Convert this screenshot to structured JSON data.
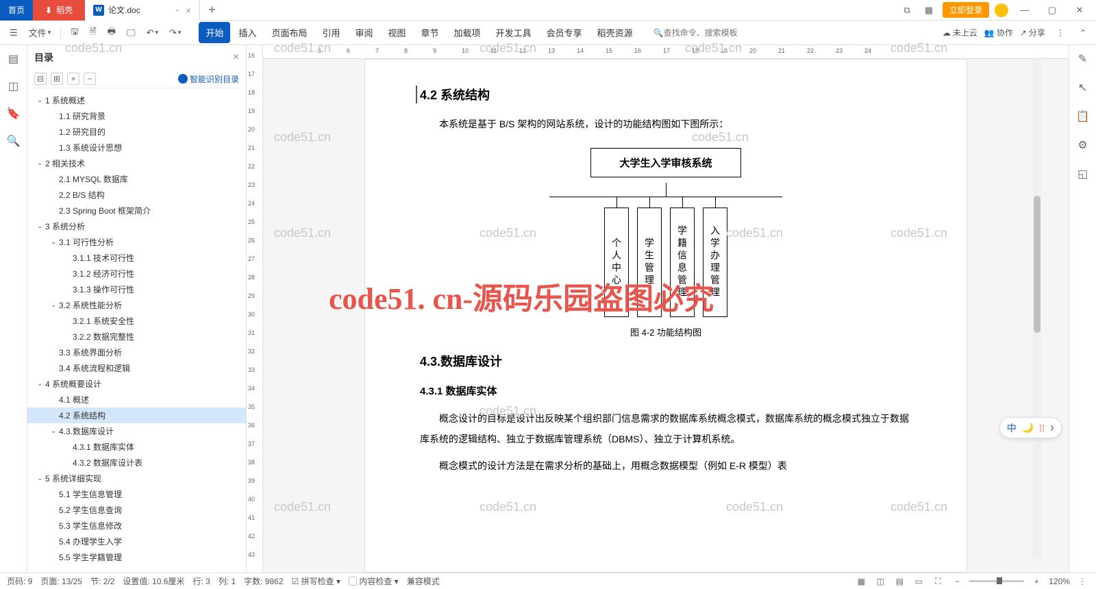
{
  "titlebar": {
    "home": "首页",
    "shell": "稻壳",
    "doc_name": "论文.doc",
    "login": "立即登录"
  },
  "toolbar": {
    "file": "文件",
    "tabs": [
      "开始",
      "插入",
      "页面布局",
      "引用",
      "审阅",
      "视图",
      "章节",
      "加载项",
      "开发工具",
      "会员专享",
      "稻壳资源"
    ],
    "search_ph": "查找命令、搜索模板",
    "cloud": "未上云",
    "collab": "协作",
    "share": "分享"
  },
  "outline": {
    "title": "目录",
    "smart": "智能识别目录",
    "items": [
      {
        "t": "1 系统概述",
        "l": 0,
        "c": true
      },
      {
        "t": "1.1 研究背景",
        "l": 1
      },
      {
        "t": "1.2 研究目的",
        "l": 1
      },
      {
        "t": "1.3 系统设计思想",
        "l": 1
      },
      {
        "t": "2 相关技术",
        "l": 0,
        "c": true
      },
      {
        "t": "2.1 MYSQL 数据库",
        "l": 1
      },
      {
        "t": "2.2 B/S 结构",
        "l": 1
      },
      {
        "t": "2.3 Spring Boot 框架简介",
        "l": 1
      },
      {
        "t": "3 系统分析",
        "l": 0,
        "c": true
      },
      {
        "t": "3.1 可行性分析",
        "l": 1,
        "c": true
      },
      {
        "t": "3.1.1 技术可行性",
        "l": 2
      },
      {
        "t": "3.1.2 经济可行性",
        "l": 2
      },
      {
        "t": "3.1.3 操作可行性",
        "l": 2
      },
      {
        "t": "3.2 系统性能分析",
        "l": 1,
        "c": true
      },
      {
        "t": "3.2.1 系统安全性",
        "l": 2
      },
      {
        "t": "3.2.2 数据完整性",
        "l": 2
      },
      {
        "t": "3.3 系统界面分析",
        "l": 1
      },
      {
        "t": "3.4 系统流程和逻辑",
        "l": 1
      },
      {
        "t": "4 系统概要设计",
        "l": 0,
        "c": true
      },
      {
        "t": "4.1 概述",
        "l": 1
      },
      {
        "t": "4.2 系统结构",
        "l": 1,
        "sel": true
      },
      {
        "t": "4.3.数据库设计",
        "l": 1,
        "c": true
      },
      {
        "t": "4.3.1 数据库实体",
        "l": 2
      },
      {
        "t": "4.3.2 数据库设计表",
        "l": 2
      },
      {
        "t": "5 系统详细实现",
        "l": 0,
        "c": true
      },
      {
        "t": "5.1 学生信息管理",
        "l": 1
      },
      {
        "t": "5.2 学生信息查询",
        "l": 1
      },
      {
        "t": "5.3 学生信息修改",
        "l": 1
      },
      {
        "t": "5.4 办理学生入学",
        "l": 1
      },
      {
        "t": "5.5 学生学籍管理",
        "l": 1
      }
    ]
  },
  "doc": {
    "h42": "4.2 系统结构",
    "p1": "本系统是基于 B/S 架构的网站系统，设计的功能结构图如下图所示：",
    "diag_root": "大学生入学审核系统",
    "diag_boxes": [
      "个人中心",
      "学生管理",
      "学籍信息管理",
      "入学办理管理"
    ],
    "diag_caption": "图 4-2 功能结构图",
    "h43": "4.3.数据库设计",
    "h431": "4.3.1 数据库实体",
    "p2": "概念设计的目标是设计出反映某个组织部门信息需求的数据库系统概念模式，数据库系统的概念模式独立于数据库系统的逻辑结构、独立于数据库管理系统（DBMS）、独立于计算机系统。",
    "p3": "概念模式的设计方法是在需求分析的基础上，用概念数据模型（例如 E-R 模型）表"
  },
  "statusbar": {
    "page_no": "页码: 9",
    "page": "页面: 13/25",
    "sec": "节: 2/2",
    "setval": "设置值: 10.6厘米",
    "line": "行: 3",
    "col": "列: 1",
    "words": "字数: 9862",
    "spell": "拼写检查",
    "content": "内容检查",
    "compat": "兼容模式",
    "zoom": "120%"
  },
  "watermark_main": "code51. cn-源码乐园盗图必究",
  "watermark_small": "code51.cn",
  "ruler_h": [
    "5",
    "6",
    "7",
    "8",
    "9",
    "10",
    "11",
    "12",
    "13",
    "14",
    "15",
    "16",
    "17",
    "18",
    "19",
    "20",
    "21",
    "22",
    "23",
    "24"
  ],
  "ruler_v": [
    "16",
    "17",
    "18",
    "19",
    "20",
    "21",
    "22",
    "23",
    "24",
    "25",
    "26",
    "27",
    "28",
    "29",
    "30",
    "31",
    "32",
    "33",
    "34",
    "35",
    "36",
    "37",
    "38",
    "39",
    "40",
    "41",
    "42",
    "43"
  ],
  "float_lang": {
    "cn": "中",
    "moon": "🌙",
    "dots": "⁞⁞",
    "arrow": "›"
  }
}
